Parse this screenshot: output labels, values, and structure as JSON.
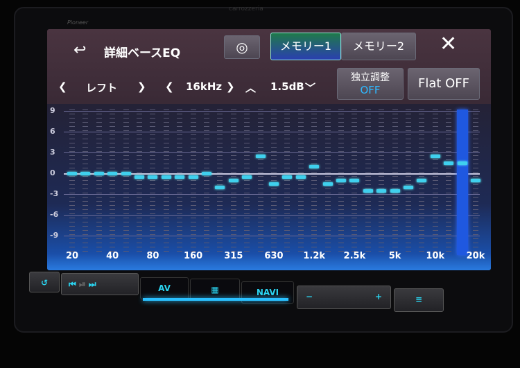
{
  "device": {
    "brand": "Pioneer",
    "model_brand": "carrozzeria"
  },
  "header": {
    "back_icon": "return-arrow-icon",
    "title": "詳細ベースEQ",
    "link_icon": "link-icon",
    "memory_tabs": [
      {
        "label": "メモリー1",
        "active": true
      },
      {
        "label": "メモリー2",
        "active": false
      }
    ],
    "close_icon": "close-x-icon"
  },
  "controls": {
    "channel": "レフト",
    "frequency": "16kHz",
    "level": "1.5dB",
    "independent": {
      "label": "独立調整",
      "value": "OFF"
    },
    "flat_label": "Flat OFF"
  },
  "colors": {
    "marker": "#3fd0ee",
    "selected_band": "#1f58e0",
    "active_tab": "#1f7a4a",
    "off_text": "#2fb8ff"
  },
  "chart_data": {
    "type": "scatter",
    "bands": [
      "20",
      "25",
      "31.5",
      "40",
      "50",
      "63",
      "80",
      "100",
      "125",
      "160",
      "200",
      "250",
      "315",
      "400",
      "500",
      "630",
      "800",
      "1k",
      "1.25k",
      "1.6k",
      "2k",
      "2.5k",
      "3.15k",
      "4k",
      "5k",
      "6.3k",
      "8k",
      "10k",
      "12.5k",
      "16k",
      "20k"
    ],
    "values": [
      0,
      0,
      0,
      0,
      0,
      -0.5,
      -0.5,
      -0.5,
      -0.5,
      -0.5,
      0,
      -2,
      -1,
      -0.5,
      2.5,
      -1.5,
      -0.5,
      -0.5,
      1,
      -1.5,
      -1,
      -1,
      -2.5,
      -2.5,
      -2.5,
      -2,
      -1,
      2.5,
      1.5,
      1.5,
      -1
    ],
    "selected_band": "16k",
    "x_tick_labels": [
      "20",
      "40",
      "80",
      "160",
      "315",
      "630",
      "1.2k",
      "2.5k",
      "5k",
      "10k",
      "20k"
    ],
    "y_tick_labels": [
      "9",
      "6",
      "3",
      "0",
      "-3",
      "-6",
      "-9"
    ],
    "ylim": [
      -9,
      9
    ],
    "grid": true
  },
  "hard_keys": {
    "back": "↺",
    "prev": "⏮",
    "pause": "⏯",
    "next": "⏭",
    "av": "AV",
    "home_icon": "grid-icon",
    "navi": "NAVI",
    "vol_down": "−",
    "vol_up": "+",
    "menu_icon": "menu-icon"
  }
}
